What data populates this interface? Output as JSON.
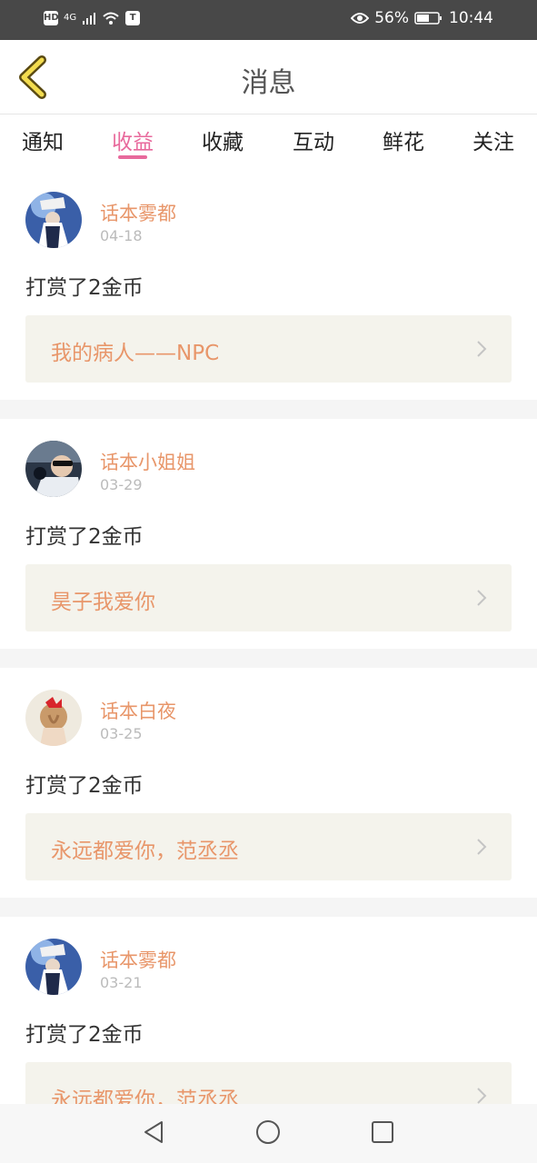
{
  "status_bar": {
    "hd": "HD",
    "network": "4G",
    "battery": "56%",
    "time": "10:44"
  },
  "header": {
    "title": "消息",
    "back_icon": "chevron-left-icon"
  },
  "tabs": [
    {
      "label": "通知",
      "active": false
    },
    {
      "label": "收益",
      "active": true
    },
    {
      "label": "收藏",
      "active": false
    },
    {
      "label": "互动",
      "active": false
    },
    {
      "label": "鲜花",
      "active": false
    },
    {
      "label": "关注",
      "active": false
    }
  ],
  "feed": [
    {
      "user": "话本雾都",
      "date": "04-18",
      "action": "打赏了2金币",
      "work_title": "我的病人——NPC"
    },
    {
      "user": "话本小姐姐",
      "date": "03-29",
      "action": "打赏了2金币",
      "work_title": "昊子我爱你"
    },
    {
      "user": "话本白夜",
      "date": "03-25",
      "action": "打赏了2金币",
      "work_title": "永远都爱你，范丞丞"
    },
    {
      "user": "话本雾都",
      "date": "03-21",
      "action": "打赏了2金币",
      "work_title": "永远都爱你，范丞丞"
    }
  ],
  "colors": {
    "accent_pink": "#e8699c",
    "accent_orange": "#e8966a",
    "link_bg": "#f4f3ec",
    "status_bar_bg": "#484848"
  },
  "nav_icons": [
    "back-triangle-icon",
    "home-circle-icon",
    "recents-square-icon"
  ]
}
